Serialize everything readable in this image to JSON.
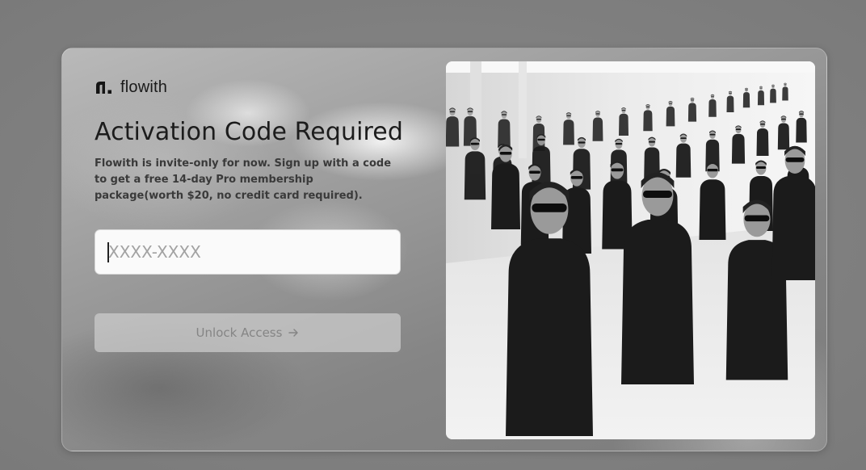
{
  "brand": {
    "name": "flowith",
    "logo_icon": "flowith-logo-icon"
  },
  "dialog": {
    "title": "Activation Code Required",
    "description": "Flowith is invite-only for now. Sign up with a code to get a free 14-day Pro membership package(worth $20, no credit card required).",
    "code_input": {
      "value": "",
      "placeholder": "XXXX-XXXX"
    },
    "unlock_button": {
      "label": "Unlock Access",
      "icon": "arrow-right-icon",
      "enabled": false
    }
  },
  "hero_image": {
    "subject": "rows of people in black suits and sunglasses",
    "style": "black-and-white photo"
  },
  "colors": {
    "page_background": "#848484",
    "title": "#1c1c1c",
    "input_background": "#fafafa",
    "button_disabled_background": "#cdcdcd",
    "button_disabled_text": "#858585"
  }
}
